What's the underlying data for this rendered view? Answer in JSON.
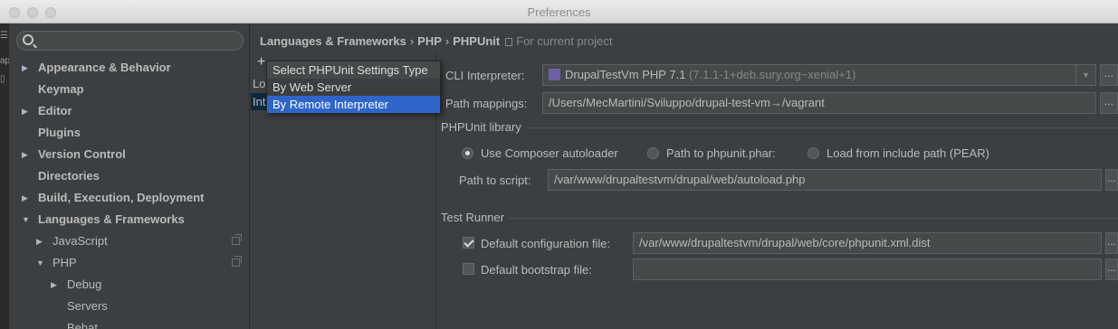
{
  "window": {
    "title": "Preferences"
  },
  "left_strip": {
    "texts": [
      "ap"
    ]
  },
  "sidebar": {
    "search_placeholder": "",
    "items": [
      {
        "label": "Appearance & Behavior",
        "arrow": "▶"
      },
      {
        "label": "Keymap",
        "arrow": ""
      },
      {
        "label": "Editor",
        "arrow": "▶"
      },
      {
        "label": "Plugins",
        "arrow": ""
      },
      {
        "label": "Version Control",
        "arrow": "▶"
      },
      {
        "label": "Directories",
        "arrow": ""
      },
      {
        "label": "Build, Execution, Deployment",
        "arrow": "▶"
      },
      {
        "label": "Languages & Frameworks",
        "arrow": "▼"
      },
      {
        "label": "JavaScript",
        "arrow": "▶"
      },
      {
        "label": "PHP",
        "arrow": "▼"
      },
      {
        "label": "Debug",
        "arrow": "▶"
      },
      {
        "label": "Servers",
        "arrow": ""
      },
      {
        "label": "Behat",
        "arrow": ""
      }
    ]
  },
  "breadcrumb": {
    "items": [
      "Languages & Frameworks",
      "PHP",
      "PHPUnit"
    ],
    "separator": "›",
    "project_label": "For current project"
  },
  "config_list": {
    "add_label": "+",
    "item1": "Lo",
    "item2": "Int"
  },
  "popup_menu": {
    "header": "Select PHPUnit Settings Type",
    "items": [
      "By Web Server",
      "By Remote Interpreter"
    ],
    "selected": "By Remote Interpreter"
  },
  "form": {
    "cli_interpreter_label": "CLI Interpreter:",
    "cli_interpreter_value": "DrupalTestVm PHP 7.1",
    "cli_interpreter_version": "(7.1.1-1+deb.sury.org~xenial+1)",
    "path_mappings_label": "Path mappings:",
    "path_mappings_value": "/Users/MecMartini/Sviluppo/drupal-test-vm→/vagrant",
    "dots_label": "...",
    "phpunit_library_title": "PHPUnit library",
    "radio_composer": "Use Composer autoloader",
    "radio_phar": "Path to phpunit.phar:",
    "radio_include": "Load from include path (PEAR)",
    "path_to_script_label": "Path to script:",
    "path_to_script_value": "/var/www/drupaltestvm/drupal/web/autoload.php",
    "test_runner_title": "Test Runner",
    "default_config_label": "Default configuration file:",
    "default_config_value": "/var/www/drupaltestvm/drupal/web/core/phpunit.xml.dist",
    "default_bootstrap_label": "Default bootstrap file:",
    "default_bootstrap_value": ""
  },
  "colors": {
    "background": "#3c3f41",
    "selection": "#2f65ca",
    "text": "#bbbbbb"
  }
}
